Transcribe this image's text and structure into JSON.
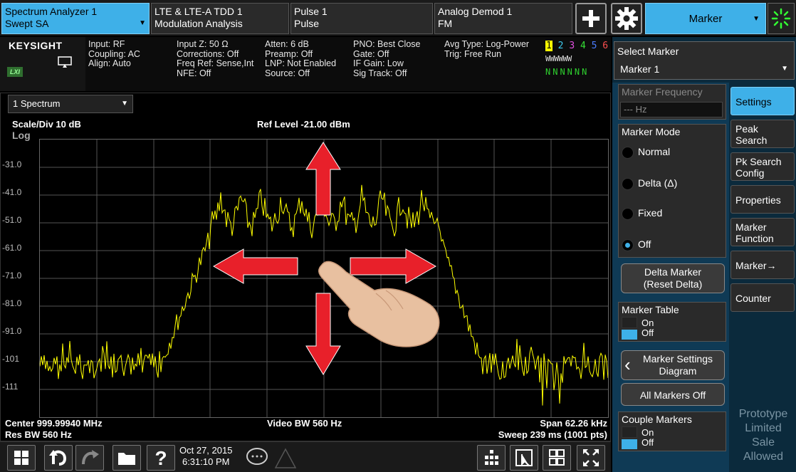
{
  "tabs": [
    {
      "line1": "Spectrum Analyzer 1",
      "line2": "Swept SA"
    },
    {
      "line1": "LTE & LTE-A TDD 1",
      "line2": "Modulation Analysis"
    },
    {
      "line1": "Pulse 1",
      "line2": "Pulse"
    },
    {
      "line1": "Analog Demod 1",
      "line2": "FM"
    }
  ],
  "menu": {
    "label": "Marker"
  },
  "logo": {
    "brand": "KEYSIGHT",
    "lxi": "LXI"
  },
  "info": {
    "col1": [
      "Input: RF",
      "Coupling: AC",
      "Align: Auto"
    ],
    "col2": [
      "Input Z: 50 Ω",
      "Corrections: Off",
      "Freq Ref: Sense,Int",
      "NFE: Off"
    ],
    "col3": [
      "Atten: 6 dB",
      "Preamp: Off",
      "LNP: Not Enabled",
      "Source: Off"
    ],
    "col4": [
      "PNO: Best Close",
      "Gate: Off",
      "IF Gain: Low",
      "Sig Track: Off"
    ],
    "col5": [
      "Avg Type: Log-Power",
      "Trig: Free Run"
    ],
    "trace_numbers": [
      "1",
      "2",
      "3",
      "4",
      "5",
      "6"
    ],
    "trace_types": "WWWWWW",
    "trace_detectors": "NNNNNN"
  },
  "select_marker": {
    "title": "Select Marker",
    "value": "Marker 1"
  },
  "marker_freq": {
    "label": "Marker Frequency",
    "value": "--- Hz"
  },
  "marker_mode": {
    "label": "Marker Mode",
    "options": [
      "Normal",
      "Delta (Δ)",
      "Fixed",
      "Off"
    ]
  },
  "delta_marker": {
    "line1": "Delta Marker",
    "line2": "(Reset Delta)"
  },
  "marker_table": {
    "label": "Marker Table",
    "on": "On",
    "off": "Off"
  },
  "marker_diagram": {
    "line1": "Marker Settings",
    "line2": "Diagram"
  },
  "all_off": "All Markers Off",
  "couple": {
    "label": "Couple Markers",
    "on": "On",
    "off": "Off"
  },
  "softkeys": [
    {
      "line1": "Settings",
      "line2": ""
    },
    {
      "line1": "Peak",
      "line2": "Search"
    },
    {
      "line1": "Pk Search",
      "line2": "Config"
    },
    {
      "line1": "Properties",
      "line2": ""
    },
    {
      "line1": "Marker",
      "line2": "Function"
    },
    {
      "line1": "Marker→",
      "line2": ""
    },
    {
      "line1": "Counter",
      "line2": ""
    }
  ],
  "watermark": [
    "Prototype",
    "Limited",
    "Sale",
    "Allowed"
  ],
  "plot": {
    "view": "1 Spectrum",
    "scale": "Scale/Div 10 dB",
    "log": "Log",
    "ref_level": "Ref Level -21.00 dBm",
    "y_ticks": [
      "-31.0",
      "-41.0",
      "-51.0",
      "-61.0",
      "-71.0",
      "-81.0",
      "-91.0",
      "-101",
      "-111"
    ],
    "center": "Center 999.99940 MHz",
    "res_bw": "Res BW 560 Hz",
    "video_bw": "Video BW 560 Hz",
    "span": "Span 62.26 kHz",
    "sweep": "Sweep 239 ms (1001 pts)"
  },
  "taskbar": {
    "date": "Oct 27, 2015",
    "time": "6:31:10 PM"
  },
  "colors": {
    "accent": "#3eb0e8",
    "trace": "#ffff00",
    "arrow": "#e8202a"
  }
}
